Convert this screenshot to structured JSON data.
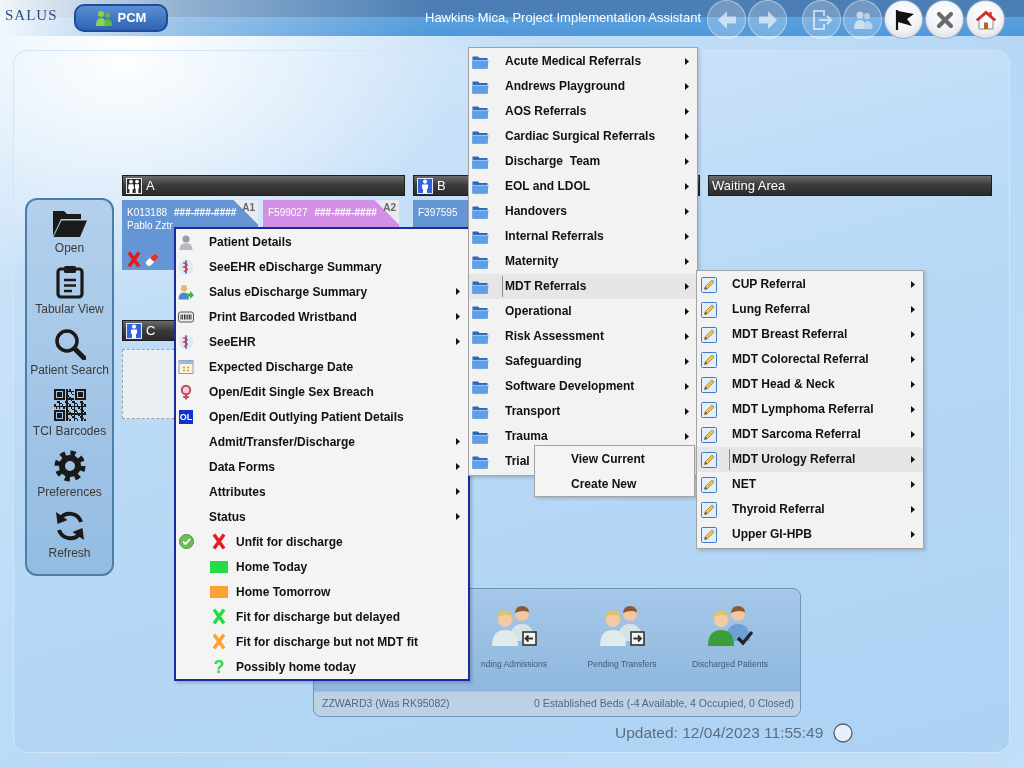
{
  "top_bar": {
    "logo": "SALUS",
    "module_button": {
      "label": "PCM"
    },
    "user": "Hawkins Mica, Project Implementation Assistant",
    "buttons": [
      {
        "kind": "back",
        "disabled": true
      },
      {
        "kind": "forward",
        "disabled": true
      },
      {
        "kind": "exit",
        "disabled": true
      },
      {
        "kind": "people",
        "disabled": true
      },
      {
        "kind": "filter",
        "disabled": false
      },
      {
        "kind": "close",
        "disabled": false
      },
      {
        "kind": "home",
        "disabled": false
      }
    ]
  },
  "sidebar": {
    "items": [
      {
        "kind": "open",
        "label": "Open"
      },
      {
        "kind": "tabular",
        "label": "Tabular View"
      },
      {
        "kind": "search",
        "label": "Patient Search"
      },
      {
        "kind": "barcodes",
        "label": "TCI Barcodes"
      },
      {
        "kind": "preferences",
        "label": "Preferences"
      },
      {
        "kind": "refresh",
        "label": "Refresh"
      }
    ]
  },
  "bay_rows": [
    [
      {
        "kind": "mixed",
        "name": "A",
        "beds": [
          {
            "kind": "patient",
            "id": "K013188",
            "nhs": "###-###-####",
            "name": "Pablo Zztr",
            "label": "A1",
            "color": "#6495d5",
            "flags": [
              {
                "kind": "unfit"
              },
              {
                "kind": "medication"
              }
            ]
          },
          {
            "kind": "patient",
            "id": "F599027",
            "nhs": "###-###-####",
            "label": "A2",
            "color": "#d48fe6"
          }
        ]
      },
      {
        "kind": "male",
        "name": "B",
        "beds": [
          {
            "kind": "patient",
            "id": "F397595",
            "color": "#6495d5"
          }
        ]
      },
      {
        "kind": "waiting",
        "name": "Waiting Area"
      }
    ],
    [
      {
        "kind": "male",
        "name": "C",
        "beds": [
          {
            "kind": "empty"
          }
        ]
      }
    ]
  ],
  "summary_panel": {
    "tiles": [
      {
        "kind": "admissions",
        "label": "nding Admissions"
      },
      {
        "kind": "transfers",
        "label": "Pending Transfers"
      },
      {
        "kind": "discharged",
        "label": "Discharged Patients"
      }
    ],
    "ward": "ZZWARD3 (Was RK95082)",
    "beds": "0 Established Beds (-4 Available, 4 Occupied, 0 Closed)"
  },
  "updated": "Updated: 12/04/2023 11:55:49",
  "context_menu": {
    "items": [
      {
        "kind": "action",
        "label": "Patient Details",
        "submenu": false
      },
      {
        "kind": "action",
        "label": "SeeEHR eDischarge Summary",
        "submenu": false
      },
      {
        "kind": "action",
        "label": "Salus eDischarge Summary",
        "submenu": true
      },
      {
        "kind": "action",
        "label": "Print Barcoded Wristband",
        "submenu": true
      },
      {
        "kind": "action",
        "label": "SeeEHR",
        "submenu": true
      },
      {
        "kind": "action",
        "label": "Expected Discharge Date",
        "submenu": false
      },
      {
        "kind": "action",
        "label": "Open/Edit Single Sex Breach",
        "submenu": false
      },
      {
        "kind": "action",
        "badge_text": "OL",
        "label": "Open/Edit Outlying Patient Details",
        "submenu": false
      },
      {
        "kind": "action",
        "label": "Admit/Transfer/Discharge",
        "submenu": true
      },
      {
        "kind": "action",
        "label": "Data Forms",
        "submenu": true
      },
      {
        "kind": "action",
        "label": "Attributes",
        "submenu": true
      },
      {
        "kind": "action",
        "label": "Status",
        "submenu": true
      },
      {
        "kind": "status",
        "checked": true,
        "mark": {
          "kind": "cross",
          "color": "#e81c1c"
        },
        "label": "Unfit for discharge"
      },
      {
        "kind": "status",
        "checked": false,
        "mark": {
          "kind": "square",
          "color": "#22dd44"
        },
        "label": "Home Today"
      },
      {
        "kind": "status",
        "checked": false,
        "mark": {
          "kind": "square",
          "color": "#ffa033"
        },
        "label": "Home Tomorrow"
      },
      {
        "kind": "status",
        "checked": false,
        "mark": {
          "kind": "cross",
          "color": "#22dd44"
        },
        "label": "Fit for discharge but delayed"
      },
      {
        "kind": "status",
        "checked": false,
        "mark": {
          "kind": "cross",
          "color": "#ffa033"
        },
        "label": "Fit for discharge but not MDT fit"
      },
      {
        "kind": "status",
        "checked": false,
        "mark": {
          "kind": "glyph",
          "glyph": "?",
          "color": "#22dd44"
        },
        "label": "Possibly home today"
      }
    ]
  },
  "referral_menu": {
    "items": [
      {
        "label": "Acute Medical Referrals",
        "submenu": true,
        "selected": false
      },
      {
        "label": "Andrews Playground",
        "submenu": true,
        "selected": false
      },
      {
        "label": "AOS Referrals",
        "submenu": true,
        "selected": false
      },
      {
        "label": "Cardiac Surgical Referrals",
        "submenu": true,
        "selected": false
      },
      {
        "label": "Discharge  Team",
        "submenu": true,
        "selected": false
      },
      {
        "label": "EOL and LDOL",
        "submenu": true,
        "selected": false
      },
      {
        "label": "Handovers",
        "submenu": true,
        "selected": false
      },
      {
        "label": "Internal Referrals",
        "submenu": true,
        "selected": false
      },
      {
        "label": "Maternity",
        "submenu": true,
        "selected": false
      },
      {
        "label": "MDT Referrals",
        "submenu": true,
        "selected": true
      },
      {
        "label": "Operational",
        "submenu": true,
        "selected": false
      },
      {
        "label": "Risk Assessment",
        "submenu": true,
        "selected": false
      },
      {
        "label": "Safeguarding",
        "submenu": true,
        "selected": false
      },
      {
        "label": "Software Development",
        "submenu": true,
        "selected": false
      },
      {
        "label": "Transport",
        "submenu": true,
        "selected": false
      },
      {
        "label": "Trauma",
        "submenu": true,
        "selected": false
      },
      {
        "label": "Trial",
        "submenu": false,
        "selected": false
      }
    ]
  },
  "mdt_menu": {
    "items": [
      {
        "label": "CUP Referral",
        "submenu": true,
        "selected": false
      },
      {
        "label": "Lung Referral",
        "submenu": true,
        "selected": false
      },
      {
        "label": "MDT Breast Referral",
        "submenu": true,
        "selected": false
      },
      {
        "label": "MDT Colorectal Referral",
        "submenu": true,
        "selected": false
      },
      {
        "label": "MDT Head & Neck",
        "submenu": true,
        "selected": false
      },
      {
        "label": "MDT Lymphoma Referral",
        "submenu": true,
        "selected": false
      },
      {
        "label": "MDT Sarcoma Referral",
        "submenu": true,
        "selected": false
      },
      {
        "label": "MDT Urology Referral",
        "submenu": true,
        "selected": true
      },
      {
        "label": "NET",
        "submenu": true,
        "selected": false
      },
      {
        "label": "Thyroid Referral",
        "submenu": true,
        "selected": false
      },
      {
        "label": "Upper GI-HPB",
        "submenu": true,
        "selected": false
      }
    ]
  },
  "urology_menu": {
    "items": [
      {
        "label": "View Current"
      },
      {
        "label": "Create New"
      }
    ]
  }
}
